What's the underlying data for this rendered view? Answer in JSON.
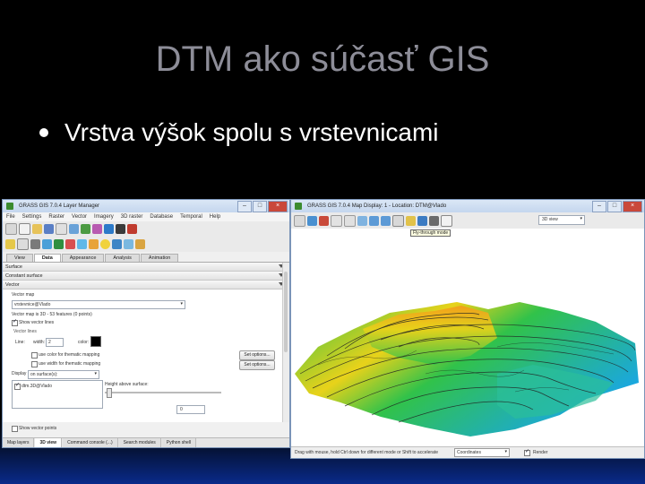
{
  "slide": {
    "title": "DTM ako súčasť GIS",
    "bullet": "Vrstva výšok spolu s vrstevnicami"
  },
  "layer_manager": {
    "window_title": "GRASS GIS 7.0.4 Layer Manager",
    "menu": [
      "File",
      "Settings",
      "Raster",
      "Vector",
      "Imagery",
      "3D raster",
      "Database",
      "Temporal",
      "Help"
    ],
    "tabs": [
      "View",
      "Data",
      "Appearance",
      "Analysis",
      "Animation"
    ],
    "active_tab": "Data",
    "sections": {
      "surface": "Surface",
      "constant_surface": "Constant surface",
      "vector": "Vector"
    },
    "vector_map_label": "Vector map",
    "vector_map_value": "vrstevnice@Vlado",
    "vector_info": "Vector map is 3D - 53 features (0 points)",
    "show_vector_lines": "Show vector lines",
    "vector_lines_label": "Vector lines",
    "line_label": "Line:",
    "width_label": "width:",
    "width_value": "2",
    "color_label": "color:",
    "use_color_thematic": "use color for thematic mapping",
    "use_width_thematic": "use width for thematic mapping",
    "set_options_1": "Set options...",
    "set_options_2": "Set options...",
    "display_label": "Display",
    "display_value": "on surface(s):",
    "surface_item": "dtm.3D@Vlado",
    "height_label": "Height above surface:",
    "height_value": "0",
    "show_vector_points": "Show vector points",
    "bottom_tabs": [
      "Map layers",
      "3D view",
      "Command console (...)",
      "Search modules",
      "Python shell"
    ],
    "active_bottom_tab": "3D view"
  },
  "map_display": {
    "window_title": "GRASS GIS 7.0.4 Map Display: 1 - Location: DTM@Vlado",
    "view_mode": "3D view",
    "tooltip": "Fly-through mode",
    "status_text": "Drag with mouse, hold Ctrl down for different mode or Shift to accelerate",
    "status_select": "Coordinates",
    "render_label": "Render"
  },
  "colors": {
    "slide_bg": "#000000",
    "title": "#8d8d98",
    "bullet": "#ffffff",
    "surface_low": "#1aa7e0",
    "surface_mid": "#31c24a",
    "surface_high": "#f59a1b",
    "surface_peak": "#e8d21a"
  }
}
